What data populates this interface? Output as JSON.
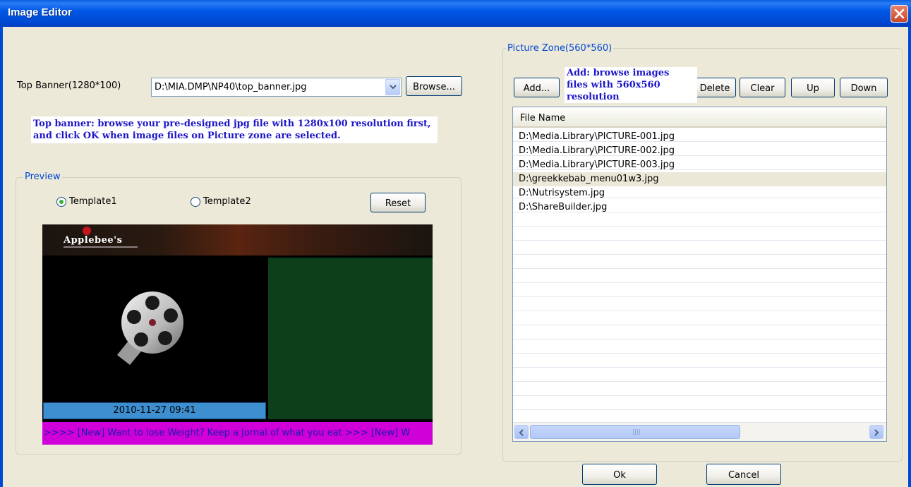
{
  "window": {
    "title": "Image Editor"
  },
  "top_banner": {
    "label": "Top Banner(1280*100)",
    "path": "D:\\MIA.DMP\\NP40\\top_banner.jpg",
    "browse_label": "Browse..."
  },
  "notes": {
    "top_banner": "Top banner: browse your pre-designed jpg file with 1280x100 resolution first, and click OK when image files on Picture zone are selected.",
    "add_line1": "Add: browse images",
    "add_line2": "files with 560x560",
    "add_line3": "resolution"
  },
  "preview": {
    "group_label": "Preview",
    "template1_label": "Template1",
    "template2_label": "Template2",
    "selected_template": "Template1",
    "reset_label": "Reset",
    "banner_logo_text": "Applebee's",
    "datetime": "2010-11-27 09:41",
    "ticker_text": ">>>> [New] Want to lose Weight? Keep a Jornal of what you eat >>> [New] W"
  },
  "picture_zone": {
    "group_label": "Picture Zone(560*560)",
    "buttons": {
      "add": "Add...",
      "delete": "Delete",
      "clear": "Clear",
      "up": "Up",
      "down": "Down"
    },
    "column_header": "File Name",
    "files": [
      "D:\\Media.Library\\PICTURE-001.jpg",
      "D:\\Media.Library\\PICTURE-002.jpg",
      "D:\\Media.Library\\PICTURE-003.jpg",
      "D:\\greekkebab_menu01w3.jpg",
      "D:\\Nutrisystem.jpg",
      "D:\\ShareBuilder.jpg"
    ],
    "selected_index": 3
  },
  "footer": {
    "ok_label": "Ok",
    "cancel_label": "Cancel"
  },
  "colors": {
    "title_bar": "#0058e6",
    "note_text": "#1c16c8",
    "group_title": "#0046d5",
    "ticker_bg": "#d000d8",
    "datebar_bg": "#3d8fd0"
  }
}
